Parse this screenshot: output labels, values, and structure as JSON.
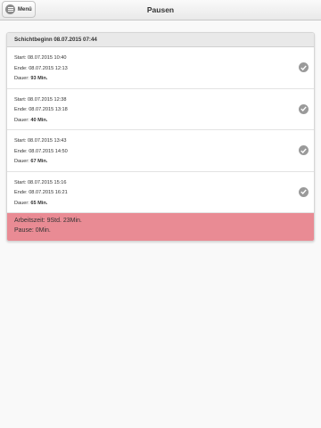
{
  "header": {
    "title": "Pausen",
    "menu_label": "Menü"
  },
  "shift": {
    "title": "Schichtbeginn 08.07.2015 07:44"
  },
  "labels": {
    "start": "Start:",
    "end": "Ende:",
    "duration": "Dauer:"
  },
  "pauses": [
    {
      "start": "08.07.2015 10:40",
      "end": "08.07.2015 12:13",
      "duration": "93 Min.",
      "icon": "check-circle-icon"
    },
    {
      "start": "08.07.2015 12:38",
      "end": "08.07.2015 13:18",
      "duration": "40 Min.",
      "icon": "check-circle-icon"
    },
    {
      "start": "08.07.2015 13:43",
      "end": "08.07.2015 14:50",
      "duration": "67 Min.",
      "icon": "check-circle-icon"
    },
    {
      "start": "08.07.2015 15:16",
      "end": "08.07.2015 16:21",
      "duration": "65 Min.",
      "icon": "check-circle-icon"
    }
  ],
  "summary": {
    "work_time": "Arbeitszeit: 9Std. 23Min.",
    "pause": "Pause: 0Min.",
    "color": "#e98b94"
  }
}
